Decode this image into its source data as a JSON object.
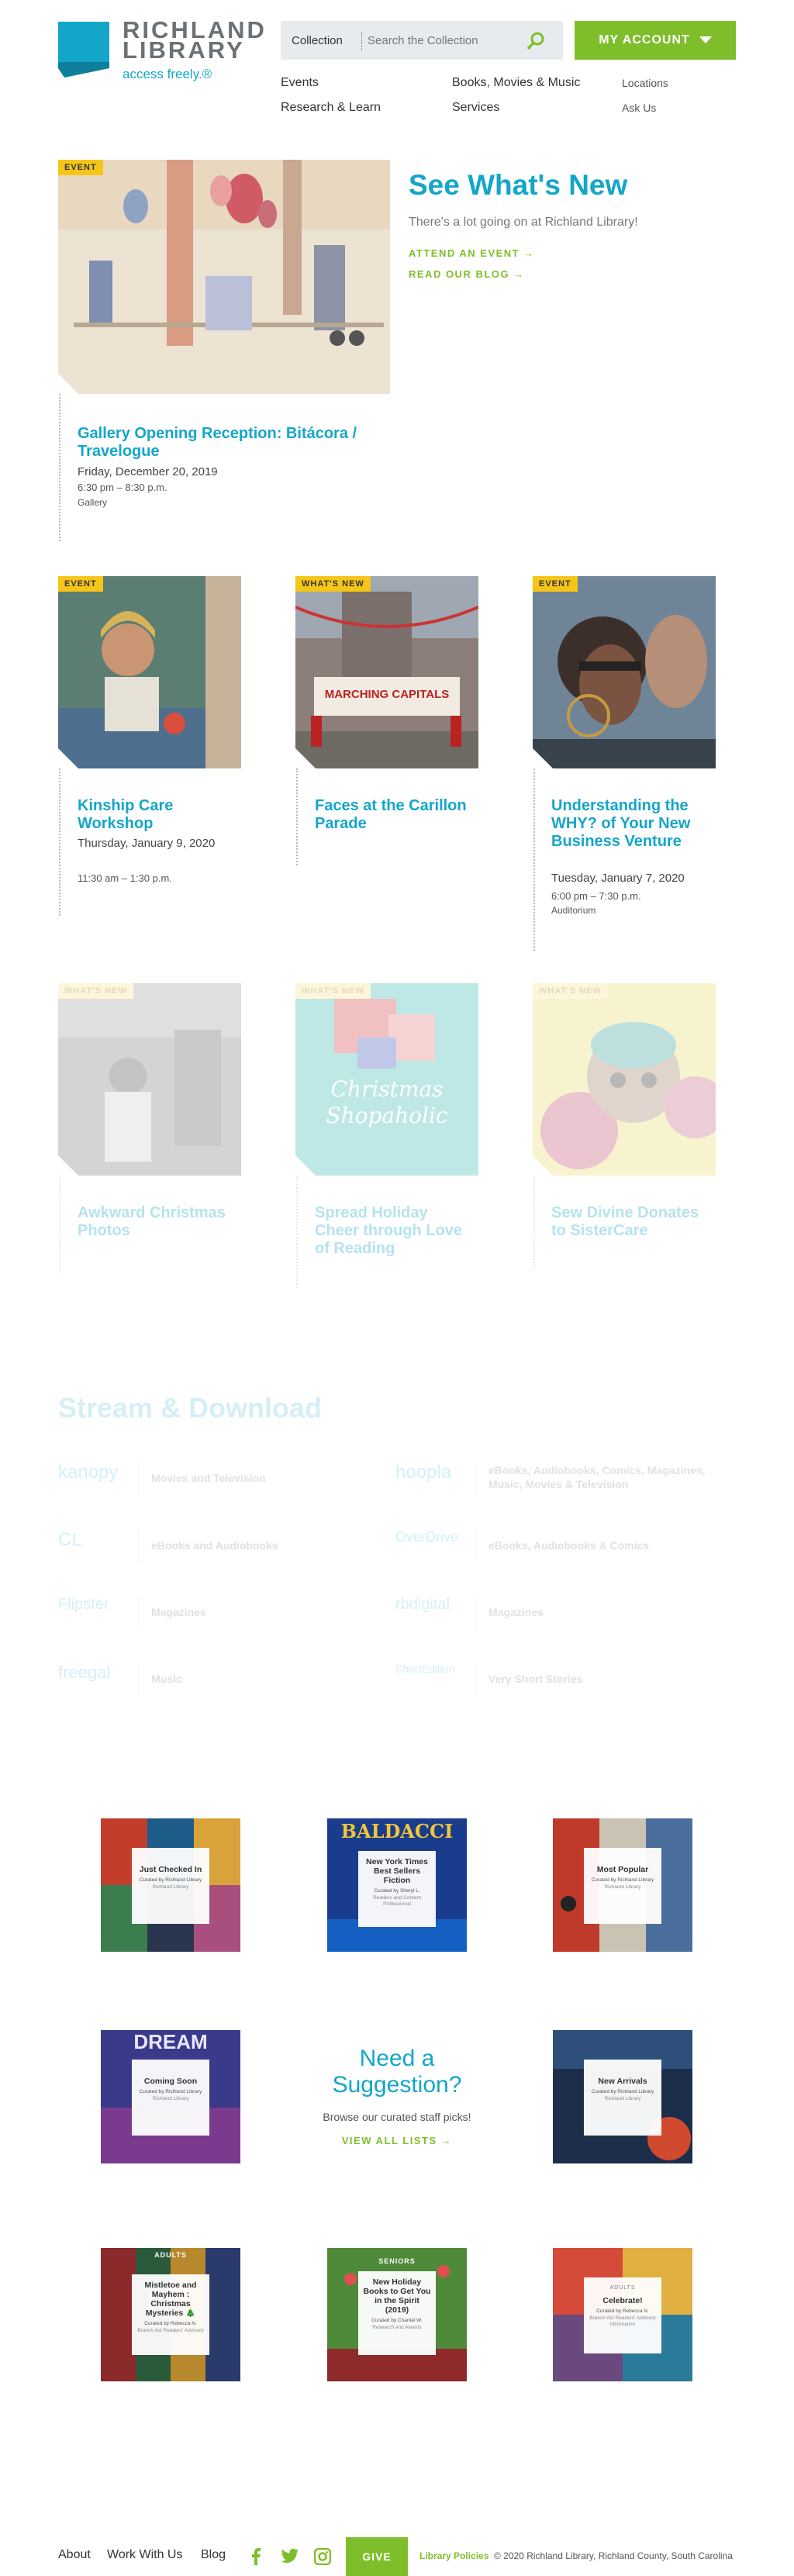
{
  "header": {
    "logo_title": "RICHLAND LIBRARY",
    "logo_tagline": "access freely.®",
    "search_scope": "Collection",
    "search_placeholder": "Search the Collection",
    "account_label": "MY ACCOUNT"
  },
  "nav": {
    "events": "Events",
    "books": "Books, Movies & Music",
    "locations": "Locations",
    "research": "Research & Learn",
    "services": "Services",
    "ask": "Ask Us"
  },
  "hero": {
    "badge": "EVENT",
    "title": "Gallery Opening Reception: Bitácora / Travelogue",
    "date": "Friday, December 20, 2019",
    "time": "6:30 pm – 8:30 p.m.",
    "location": "Gallery",
    "heading": "See What's New",
    "subheading": "There's a lot going on at Richland Library!",
    "link1": "ATTEND AN EVENT →",
    "link2": "READ OUR BLOG →"
  },
  "cards_row1": [
    {
      "badge": "EVENT",
      "title": "Kinship Care Workshop",
      "date": "Thursday, January 9, 2020",
      "time": "11:30 am – 1:30 p.m.",
      "location": ""
    },
    {
      "badge": "WHAT'S NEW",
      "title": "Faces at the Carillon Parade",
      "date": "",
      "time": "",
      "location": ""
    },
    {
      "badge": "EVENT",
      "title": "Understanding the WHY? of Your New Business Venture",
      "date": "Tuesday, January 7, 2020",
      "time": "6:00 pm – 7:30 p.m.",
      "location": "Auditorium"
    }
  ],
  "cards_row2": [
    {
      "badge": "WHAT'S NEW",
      "title": "Awkward Christmas Photos"
    },
    {
      "badge": "WHAT'S NEW",
      "title": "Spread Holiday Cheer through Love of Reading",
      "image_text": "Christmas Shopaholic"
    },
    {
      "badge": "WHAT'S NEW",
      "title": "Sew Divine Donates to SisterCare"
    }
  ],
  "parade_banner": "MARCHING CAPITALS",
  "stream": {
    "title": "Stream & Download",
    "items": [
      {
        "logo": "kanopy",
        "desc": "Movies and Television"
      },
      {
        "logo": "hoopla",
        "desc": "eBooks, Audiobooks, Comics, Magazines, Music, Movies & Television"
      },
      {
        "logo": "CL",
        "desc": "eBooks and Audiobooks"
      },
      {
        "logo": "OverDrive",
        "desc": "eBooks, Audiobooks & Comics"
      },
      {
        "logo": "Flipster",
        "desc": "Magazines"
      },
      {
        "logo": "rbdigital",
        "desc": "Magazines"
      },
      {
        "logo": "freegal",
        "desc": "Music"
      },
      {
        "logo": "ShortEdition",
        "desc": "Very Short Stories"
      }
    ]
  },
  "lists": [
    {
      "title": "Just Checked In",
      "curator": "Curated by Richland Library",
      "sub": "Richland Library"
    },
    {
      "title": "New York Times Best Sellers Fiction",
      "curator": "Curated by Sheryl L.",
      "sub": "Readers and Content Professional"
    },
    {
      "title": "Most Popular",
      "curator": "Curated by Richland Library",
      "sub": "Richland Library"
    },
    {
      "title": "Coming Soon",
      "curator": "Curated by Richland Library",
      "sub": "Richland Library"
    },
    {
      "title": "New Arrivals",
      "curator": "Curated by Richland Library",
      "sub": "Richland Library"
    },
    {
      "title": "Mistletoe and Mayhem : Christmas Mysteries 🎄",
      "curator": "Curated by Rebecca N.",
      "sub": "Branch Act Readers' Advisory"
    },
    {
      "title": "New Holiday Books to Get You in the Spirit (2019)",
      "curator": "Curated by Chantel W.",
      "sub": "Research and Awards"
    },
    {
      "title": "Celebrate!",
      "curator": "Curated by Rebecca N.",
      "sub": "Branch Act Readers' Advisory Information"
    }
  ],
  "cover_texts": {
    "baldacci": "BALDACCI",
    "dream": "DREAM",
    "adults": "ADULTS",
    "seniors": "SENIORS"
  },
  "suggestion": {
    "title": "Need a Suggestion?",
    "subtitle": "Browse our curated staff picks!",
    "link": "VIEW ALL LISTS →"
  },
  "footer": {
    "about": "About",
    "work": "Work With Us",
    "blog": "Blog",
    "give": "GIVE",
    "policies": "Library Policies",
    "copyright": "© 2020 Richland Library, Richland County, South Carolina"
  },
  "colors": {
    "brand_blue": "#14a6c9",
    "brand_green": "#7fbe2b",
    "badge_yellow": "#f5c518"
  }
}
